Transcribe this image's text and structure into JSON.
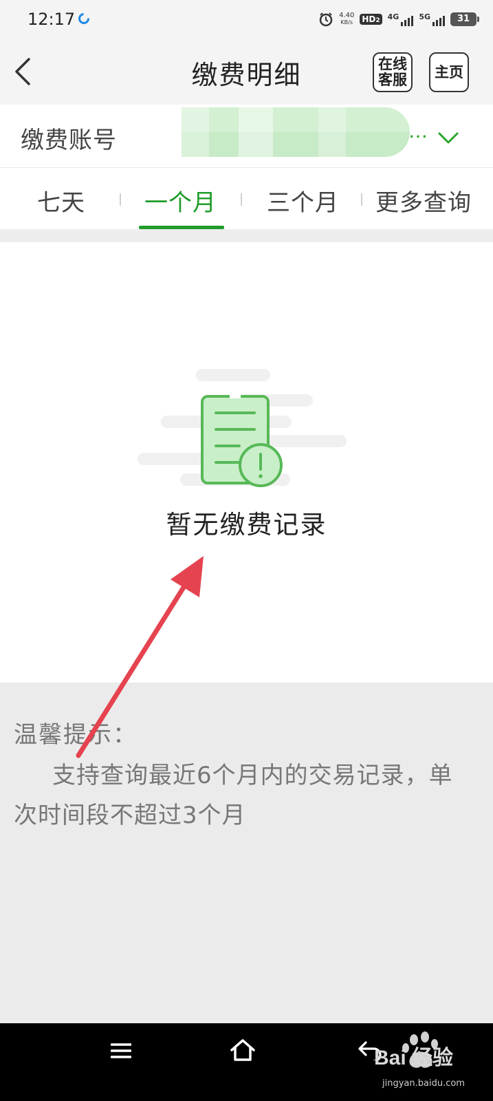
{
  "status_bar": {
    "time": "12:17",
    "speed_value": "4.40",
    "speed_unit": "KB/s",
    "hd": "HD",
    "hd_sub": "2",
    "net1": "4G",
    "net2": "5G",
    "battery": "31"
  },
  "header": {
    "title": "缴费明细",
    "service_button": "在线客服",
    "home_button": "主页"
  },
  "account": {
    "label": "缴费账号",
    "value_tail": "…"
  },
  "tabs": [
    {
      "label": "七天",
      "active": false
    },
    {
      "label": "一个月",
      "active": true
    },
    {
      "label": "三个月",
      "active": false
    },
    {
      "label": "更多查询",
      "active": false
    }
  ],
  "empty_state": {
    "message": "暂无缴费记录"
  },
  "tips": {
    "title": "温馨提示：",
    "body": "支持查询最近6个月内的交易记录，单次时间段不超过3个月"
  },
  "watermark": {
    "brand": "Bai 经验",
    "url": "jingyan.baidu.com"
  },
  "colors": {
    "accent": "#1f9c2a",
    "annotation": "#e5434f"
  }
}
